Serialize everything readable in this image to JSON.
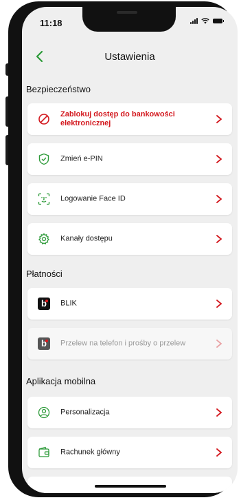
{
  "status_bar": {
    "time": "11:18"
  },
  "header": {
    "title": "Ustawienia"
  },
  "sections": {
    "security": {
      "title": "Bezpieczeństwo",
      "items": [
        {
          "label": "Zablokuj dostęp do bankowości elektronicznej",
          "icon": "block-icon"
        },
        {
          "label": "Zmień e-PIN",
          "icon": "shield-check-icon"
        },
        {
          "label": "Logowanie Face ID",
          "icon": "face-id-icon"
        },
        {
          "label": "Kanały dostępu",
          "icon": "gear-icon"
        }
      ]
    },
    "payments": {
      "title": "Płatności",
      "items": [
        {
          "label": "BLIK",
          "icon": "blik-icon"
        },
        {
          "label": "Przelew na telefon i prośby o przelew",
          "icon": "blik-icon"
        }
      ]
    },
    "mobile_app": {
      "title": "Aplikacja mobilna",
      "items": [
        {
          "label": "Personalizacja",
          "icon": "user-icon"
        },
        {
          "label": "Rachunek główny",
          "icon": "wallet-icon"
        }
      ]
    }
  },
  "colors": {
    "accent": "#2e9b3a",
    "danger": "#d3181e",
    "chevron": "#d3181e",
    "background": "#efefef"
  }
}
